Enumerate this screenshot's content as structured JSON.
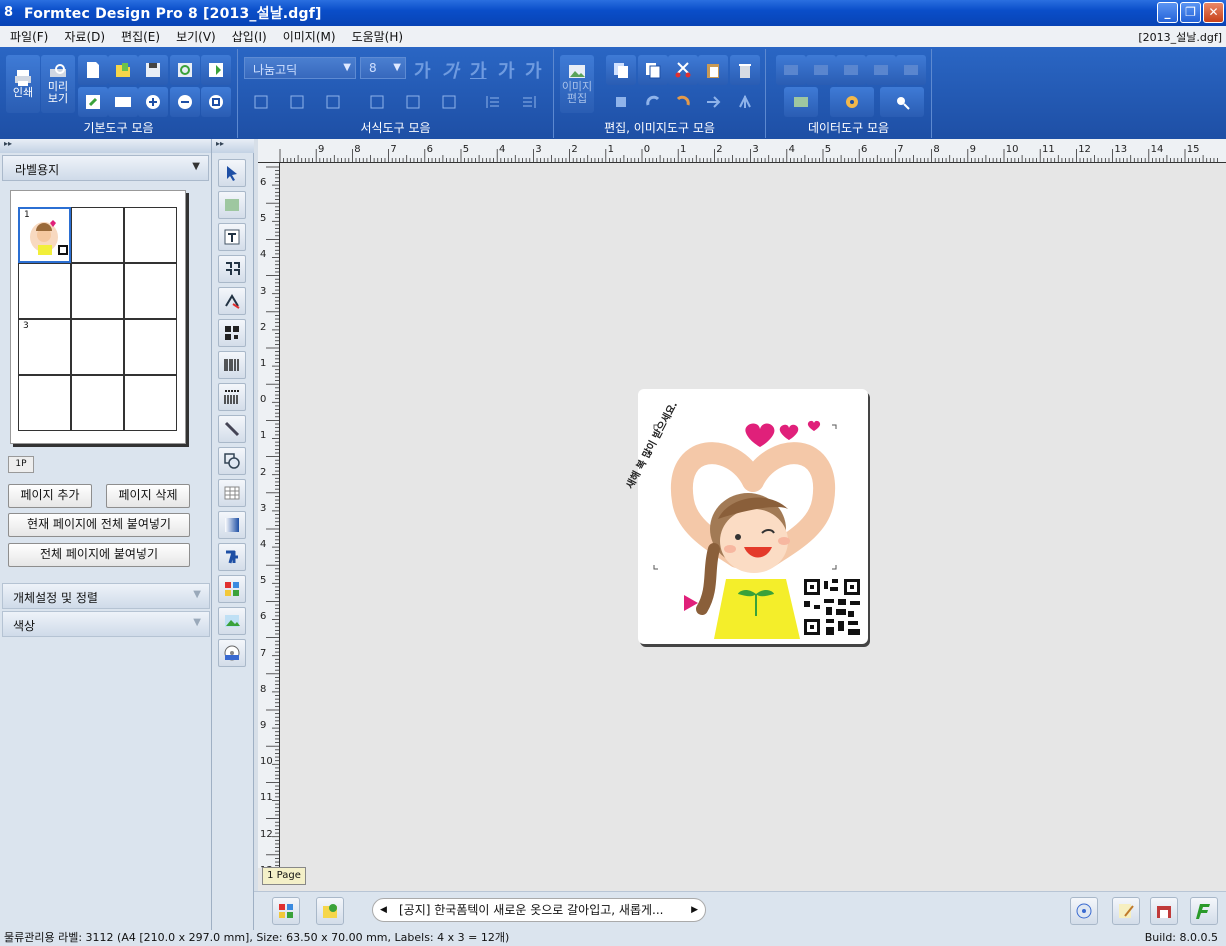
{
  "window": {
    "title": "Formtec Design Pro 8 [2013_설날.dgf]",
    "app_icon": "8"
  },
  "menu": {
    "items": [
      "파일(F)",
      "자료(D)",
      "편집(E)",
      "보기(V)",
      "삽입(I)",
      "이미지(M)",
      "도움말(H)"
    ],
    "doc_name": "[2013_설날.dgf]"
  },
  "ribbon": {
    "groups": [
      "기본도구 모음",
      "서식도구 모음",
      "편집, 이미지도구 모음",
      "데이터도구 모음"
    ],
    "print_label": "인쇄",
    "preview_label": "미리\n보기",
    "image_edit_label": "이미지\n편집",
    "font_name": "나눔고딕",
    "font_size": "8",
    "font_style_glyph": "가"
  },
  "left_panel": {
    "paper_type": "라벨용지",
    "page_tab": "1P",
    "cell_numbers": [
      "1",
      "3"
    ],
    "buttons": {
      "add_page": "페이지 추가",
      "delete_page": "페이지 삭제",
      "paste_all_current": "현재 페이지에 전체 붙여넣기",
      "paste_all_pages": "전체 페이지에 붙여넣기"
    },
    "sections": [
      "개체설정 및 정렬",
      "색상"
    ]
  },
  "canvas": {
    "page_tab": "1 Page",
    "ruler_top": [
      "9",
      "8",
      "7",
      "6",
      "5",
      "4",
      "3",
      "2",
      "1",
      "0",
      "1",
      "2",
      "3",
      "4",
      "5",
      "6",
      "7",
      "8",
      "9",
      "10",
      "11",
      "12",
      "13",
      "14",
      "15"
    ],
    "ruler_left": [
      "6",
      "5",
      "4",
      "3",
      "2",
      "1",
      "0",
      "1",
      "2",
      "3",
      "4",
      "5",
      "6",
      "7",
      "8",
      "9",
      "10",
      "11",
      "12",
      "13"
    ],
    "label_text": "새해 복 많이 받으세요."
  },
  "bottombar": {
    "notice": "[공지] 한국폼텍이 새로운 옷으로 갈아입고, 새롭게..."
  },
  "status": {
    "text": "물류관리용 라벨: 3112 (A4 [210.0 x 297.0 mm], Size: 63.50 x 70.00 mm, Labels: 4 x 3 = 12개)",
    "build": "Build: 8.0.0.5"
  }
}
